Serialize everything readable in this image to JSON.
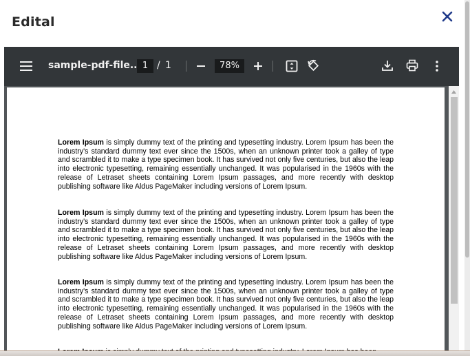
{
  "modal": {
    "title": "Edital",
    "close_icon": "close-icon"
  },
  "viewer": {
    "file_name": "sample-pdf-file...",
    "current_page": "1",
    "page_separator": "/",
    "total_pages": "1",
    "zoom": "78%",
    "icons": [
      "menu-icon",
      "zoom-out-icon",
      "zoom-in-icon",
      "fit-page-icon",
      "rotate-icon",
      "download-icon",
      "print-icon",
      "more-options-icon"
    ]
  },
  "document": {
    "paragraphs": [
      {
        "lead": "Lorem Ipsum",
        "text": " is simply dummy text of the printing and typesetting industry. Lorem Ipsum has been the industry's standard dummy text ever since the 1500s, when an unknown printer took a galley of type and scrambled it to make a type specimen book. It has survived not only five centuries, but also the leap into electronic typesetting, remaining essentially unchanged. It was popularised in the 1960s with the release of Letraset sheets containing Lorem Ipsum passages, and more recently with desktop publishing software like Aldus PageMaker including versions of Lorem Ipsum."
      },
      {
        "lead": "Lorem Ipsum",
        "text": " is simply dummy text of the printing and typesetting industry. Lorem Ipsum has been the industry's standard dummy text ever since the 1500s, when an unknown printer took a galley of type and scrambled it to make a type specimen book. It has survived not only five centuries, but also the leap into electronic typesetting, remaining essentially unchanged. It was popularised in the 1960s with the release of Letraset sheets containing Lorem Ipsum passages, and more recently with desktop publishing software like Aldus PageMaker including versions of Lorem Ipsum."
      },
      {
        "lead": "Lorem Ipsum",
        "text": " is simply dummy text of the printing and typesetting industry. Lorem Ipsum has been the industry's standard dummy text ever since the 1500s, when an unknown printer took a galley of type and scrambled it to make a type specimen book. It has survived not only five centuries, but also the leap into electronic typesetting, remaining essentially unchanged. It was popularised in the 1960s with the release of Letraset sheets containing Lorem Ipsum passages, and more recently with desktop publishing software like Aldus PageMaker including versions of Lorem Ipsum."
      },
      {
        "lead": "Lorem Ipsum",
        "text": " is simply dummy text of the printing and typesetting industry. Lorem Ipsum has been"
      }
    ]
  },
  "colors": {
    "toolbar": "#323639",
    "viewer_background": "#525659",
    "close_accent": "#1f3a8a"
  }
}
